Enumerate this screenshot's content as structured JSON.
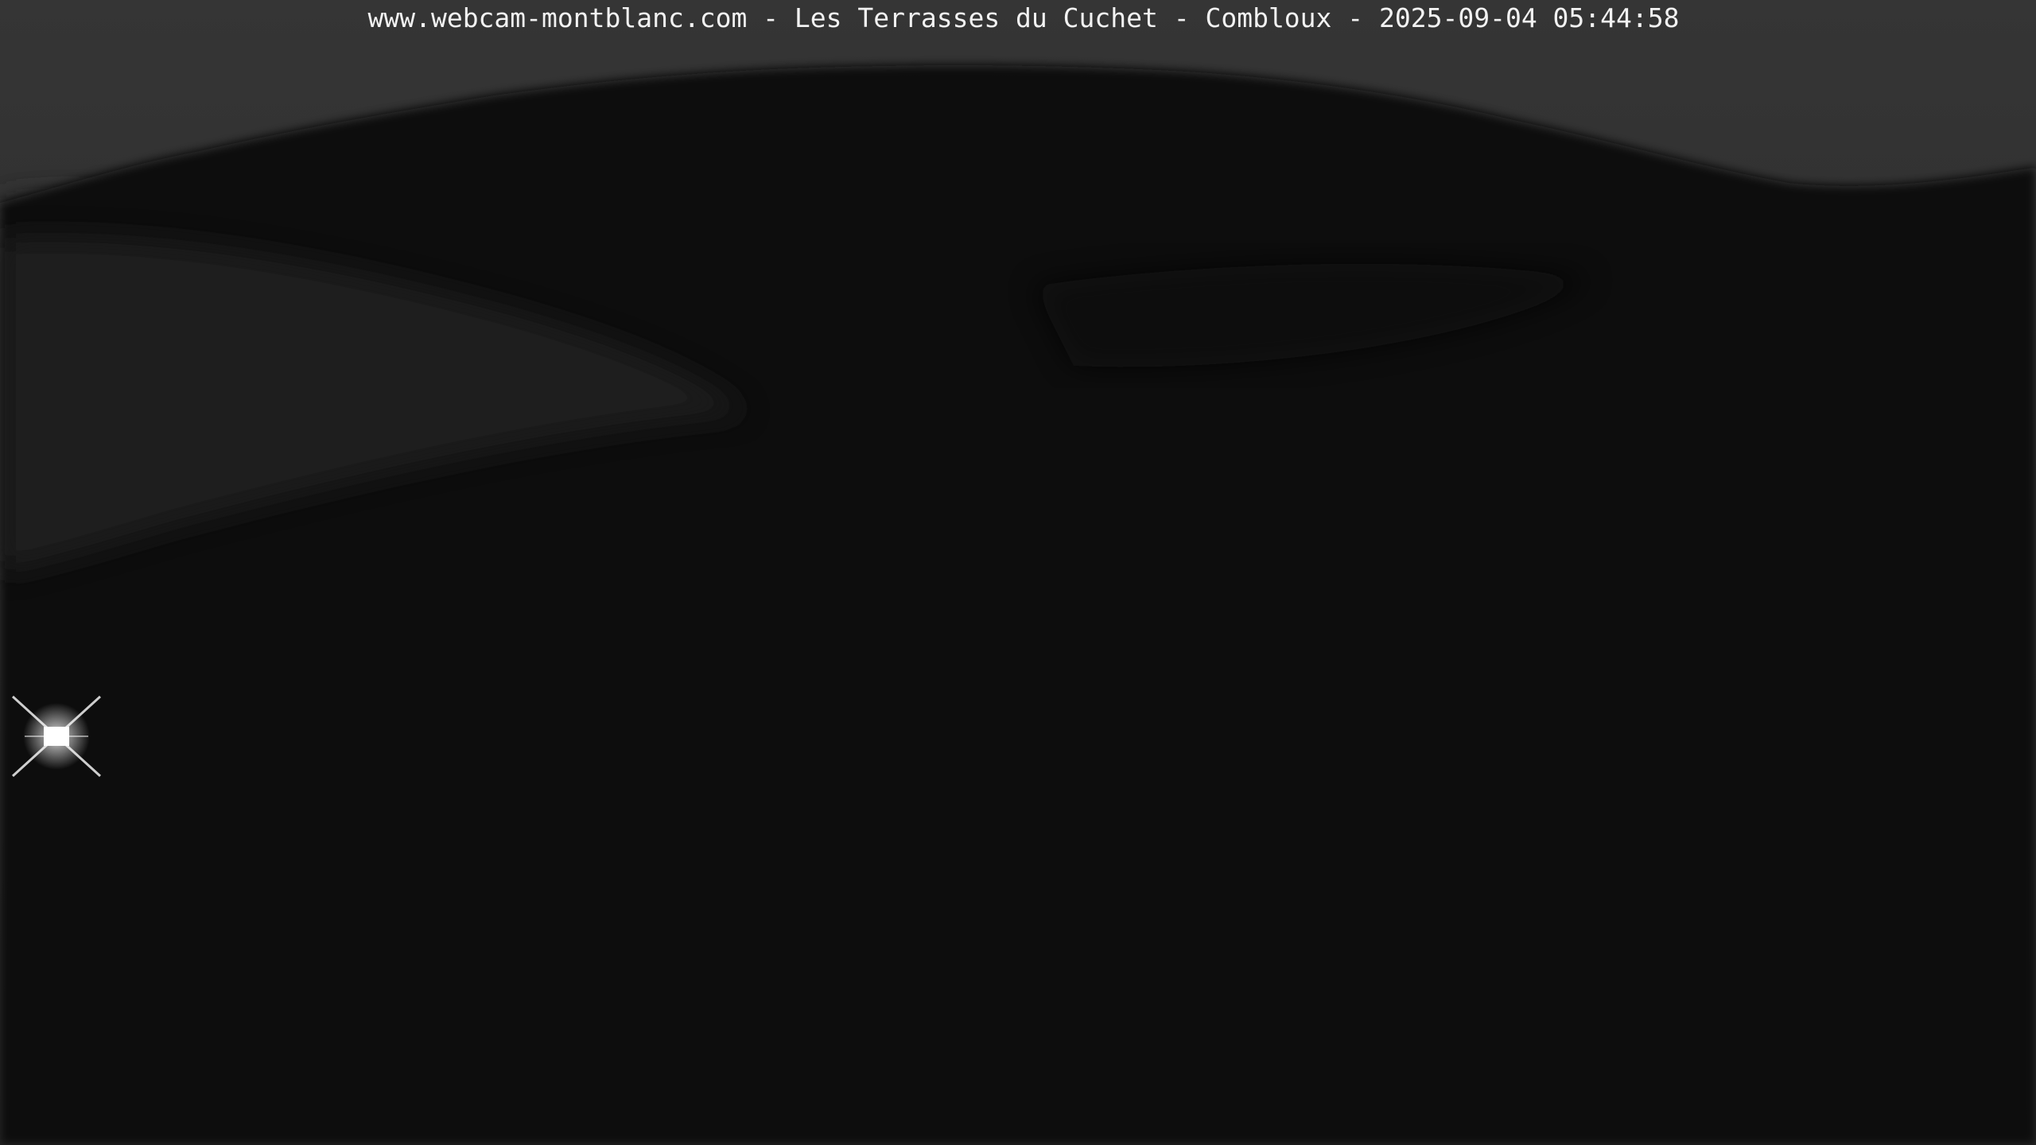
{
  "caption": "www.webcam-montblanc.com - Les Terrasses du Cuchet - Combloux - 2025-09-04 05:44:58",
  "colors": {
    "sky": "#2c2c2c",
    "sky_light": "#3a3a3a",
    "mountain": "#060606",
    "cloud": "#252525",
    "light": "#ffffff"
  }
}
